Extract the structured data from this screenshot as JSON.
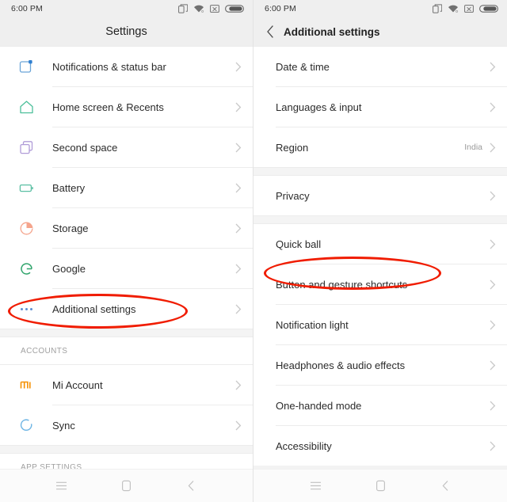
{
  "statusbar": {
    "time": "6:00 PM",
    "icons": [
      "dual-sim-icon",
      "wifi-icon",
      "no-signal-icon",
      "battery-icon"
    ]
  },
  "left_screen": {
    "title": "Settings",
    "items": [
      {
        "label": "Notifications & status bar",
        "icon": "notifications-icon",
        "color": "#4a90d9"
      },
      {
        "label": "Home screen & Recents",
        "icon": "home-icon",
        "color": "#4cbf9a"
      },
      {
        "label": "Second space",
        "icon": "second-space-icon",
        "color": "#b09cd8"
      },
      {
        "label": "Battery",
        "icon": "battery-settings-icon",
        "color": "#5bbfa3"
      },
      {
        "label": "Storage",
        "icon": "storage-icon",
        "color": "#f5a48c"
      },
      {
        "label": "Google",
        "icon": "google-g-icon",
        "color": "#2fa46b"
      },
      {
        "label": "Additional settings",
        "icon": "more-dots-icon",
        "color": "#5b8fd4"
      }
    ],
    "accounts_header": "ACCOUNTS",
    "accounts": [
      {
        "label": "Mi Account",
        "icon": "mi-logo-icon",
        "color": "#f59000"
      },
      {
        "label": "Sync",
        "icon": "sync-icon",
        "color": "#6cb4e4"
      }
    ],
    "app_settings_header": "APP SETTINGS",
    "highlight": "Additional settings"
  },
  "right_screen": {
    "title": "Additional settings",
    "back_icon": "back-chevron-icon",
    "groups": [
      {
        "items": [
          {
            "label": "Date & time",
            "value": ""
          },
          {
            "label": "Languages & input",
            "value": ""
          },
          {
            "label": "Region",
            "value": "India"
          }
        ]
      },
      {
        "items": [
          {
            "label": "Privacy",
            "value": ""
          }
        ]
      },
      {
        "items": [
          {
            "label": "Quick ball",
            "value": ""
          },
          {
            "label": "Button and gesture shortcuts",
            "value": ""
          },
          {
            "label": "Notification light",
            "value": ""
          },
          {
            "label": "Headphones & audio effects",
            "value": ""
          },
          {
            "label": "One-handed mode",
            "value": ""
          },
          {
            "label": "Accessibility",
            "value": ""
          }
        ]
      }
    ],
    "highlight": "Button and gesture shortcuts"
  },
  "navbar": {
    "menu_icon": "menu-icon",
    "home_icon": "home-square-icon",
    "back_icon": "back-chevron-icon"
  },
  "colors": {
    "annotation": "#f01c00",
    "statusbar_bg": "#efefef",
    "divider": "#ececec"
  }
}
